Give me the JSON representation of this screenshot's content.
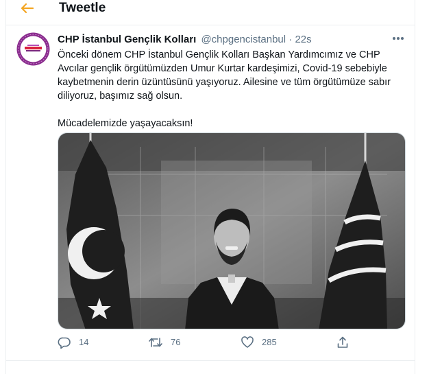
{
  "colors": {
    "accent": "#f4a623",
    "text_primary": "#0f1419",
    "text_secondary": "#5b7083",
    "divider": "#ebeef0",
    "avatar_ring": "#8a2c8e"
  },
  "header": {
    "back_icon": "arrow-left-icon",
    "title": "Tweetle"
  },
  "tweet": {
    "author": {
      "name": "CHP İstanbul Gençlik Kolları",
      "handle": "@chpgencistanbul"
    },
    "separator": "·",
    "time": "22s",
    "more_icon": "more-icon",
    "text": [
      "Önceki dönem CHP İstanbul Gençlik Kolları Başkan Yardımcımız ve CHP Avcılar gençlik örgütümüzden Umur Kurtar kardeşimizi, Covid-19 sebebiyle kaybetmenin derin üzüntüsünü yaşıyoruz. Ailesine ve tüm örgütümüze sabır diliyoruz, başımız sağ olsun.",
      "Mücadelemizde yaşayacaksın!"
    ],
    "media": {
      "description_icon": "photo"
    },
    "actions": {
      "reply": {
        "icon": "reply-icon",
        "count": "14"
      },
      "retweet": {
        "icon": "retweet-icon",
        "count": "76"
      },
      "like": {
        "icon": "heart-icon",
        "count": "285"
      },
      "share": {
        "icon": "share-icon"
      }
    }
  }
}
